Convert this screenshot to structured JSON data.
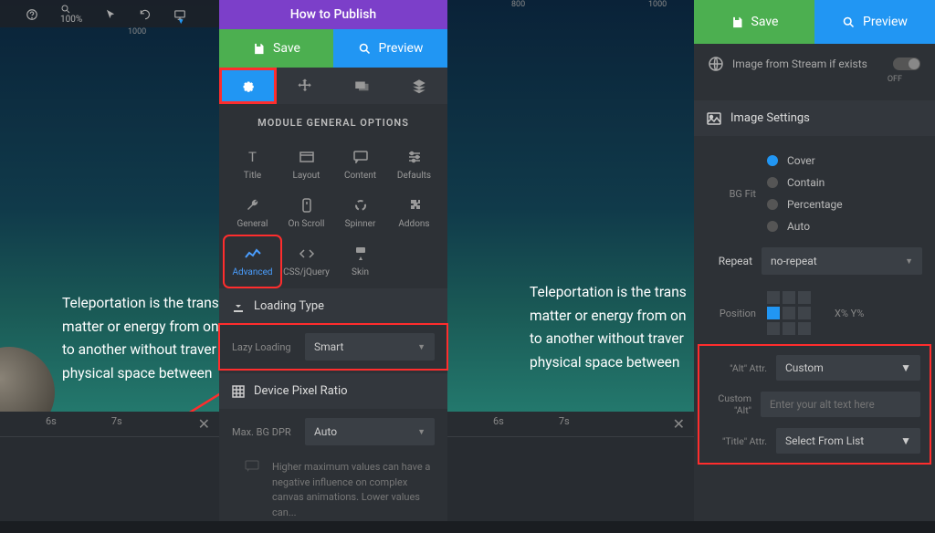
{
  "toolbar": {
    "zoom": "100%"
  },
  "ruler": {
    "m1": "1000",
    "m2": "800",
    "m3": "1000"
  },
  "canvas": {
    "line1": "Teleportation is the trans",
    "line2": "matter or energy from on",
    "line3": "to another without traver",
    "line4": "physical space between"
  },
  "timeline": {
    "t1": "6s",
    "t2": "7s"
  },
  "header": {
    "howto": "How to Publish",
    "save": "Save",
    "preview": "Preview"
  },
  "section": {
    "title": "MODULE GENERAL OPTIONS",
    "items": [
      "Title",
      "Layout",
      "Content",
      "Defaults",
      "General",
      "On Scroll",
      "Spinner",
      "Addons",
      "Advanced",
      "CSS/jQuery",
      "Skin"
    ]
  },
  "loading": {
    "header": "Loading Type",
    "lazy_label": "Lazy Loading",
    "lazy_value": "Smart"
  },
  "dpr": {
    "header": "Device Pixel Ratio",
    "max_label": "Max. BG DPR",
    "max_value": "Auto",
    "hint": "Higher maximum values can have a negative influence on complex canvas animations. Lower values can..."
  },
  "right": {
    "stream_label": "Image from Stream if exists",
    "stream_state": "OFF",
    "img_settings": "Image Settings",
    "bgfit_label": "BG Fit",
    "bgfit_opts": [
      "Cover",
      "Contain",
      "Percentage",
      "Auto"
    ],
    "repeat_label": "Repeat",
    "repeat_value": "no-repeat",
    "position_label": "Position",
    "position_coord": "X% Y%",
    "alt_label": "\"Alt\" Attr.",
    "alt_value": "Custom",
    "custom_alt_label": "Custom \"Alt\"",
    "custom_alt_placeholder": "Enter your alt text here",
    "title_label": "\"Title\" Attr.",
    "title_value": "Select From List"
  }
}
